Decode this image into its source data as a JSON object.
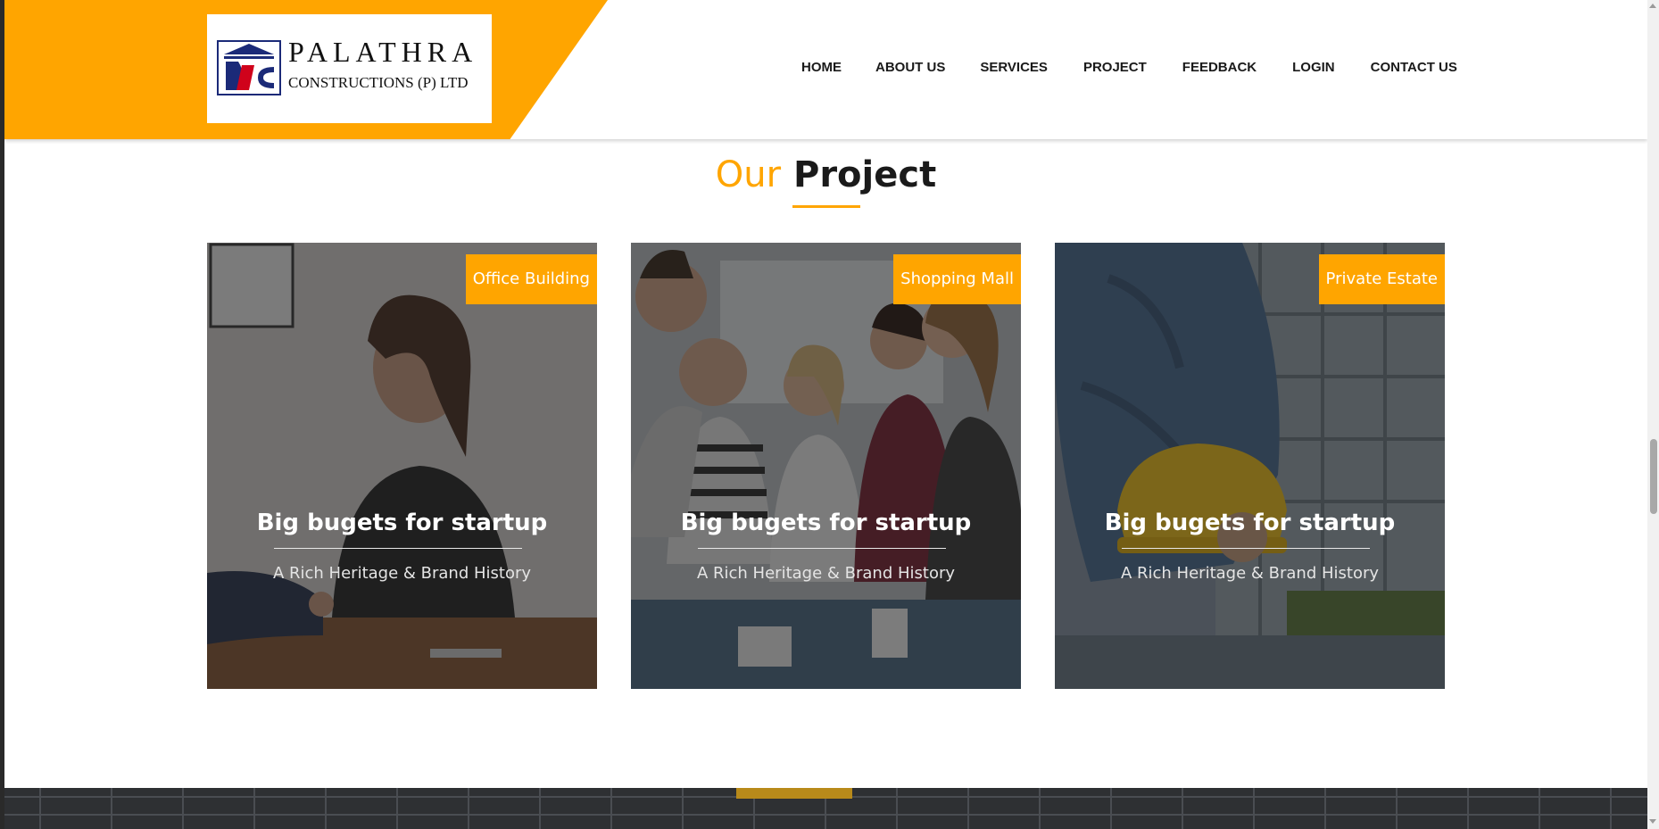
{
  "brand": {
    "name": "PALATHRA",
    "subtitle": "CONSTRUCTIONS (P) LTD",
    "accent_color": "#ffa500",
    "logo_icon": "pdc-monogram-icon"
  },
  "nav": {
    "items": [
      {
        "label": "HOME"
      },
      {
        "label": "ABOUT US"
      },
      {
        "label": "SERVICES"
      },
      {
        "label": "PROJECT"
      },
      {
        "label": "FEEDBACK"
      },
      {
        "label": "LOGIN"
      },
      {
        "label": "CONTACT US"
      }
    ]
  },
  "section": {
    "title_part1": "Our",
    "title_part2": "Project"
  },
  "projects": [
    {
      "tag": "Office Building",
      "title": "Big bugets for startup",
      "subtitle": "A Rich Heritage & Brand History"
    },
    {
      "tag": "Shopping Mall",
      "title": "Big bugets for startup",
      "subtitle": "A Rich Heritage & Brand History"
    },
    {
      "tag": "Private Estate",
      "title": "Big bugets for startup",
      "subtitle": "A Rich Heritage & Brand History"
    }
  ]
}
